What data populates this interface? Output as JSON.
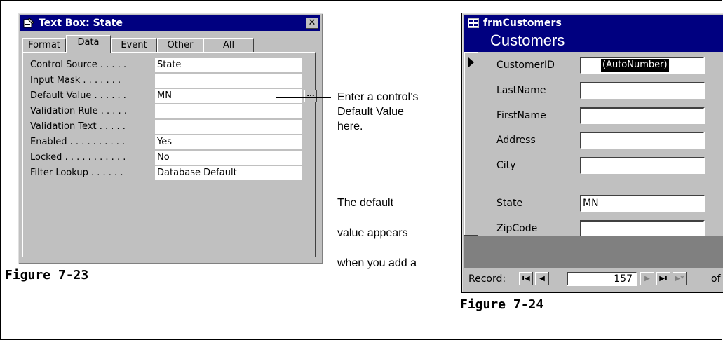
{
  "properties_window": {
    "title": "Text Box: State",
    "close_glyph": "✕",
    "tabs": [
      "Format",
      "Data",
      "Event",
      "Other",
      "All"
    ],
    "active_tab": "Data",
    "properties": [
      {
        "label": "Control Source . . . . .",
        "value": "State"
      },
      {
        "label": "Input Mask . . . . . . .",
        "value": ""
      },
      {
        "label": "Default Value . . . . . .",
        "value": "MN"
      },
      {
        "label": "Validation Rule . . . . .",
        "value": ""
      },
      {
        "label": "Validation Text . . . . .",
        "value": ""
      },
      {
        "label": "Enabled . . . . . . . . . .",
        "value": "Yes"
      },
      {
        "label": "Locked . . . . . . . . . . .",
        "value": "No"
      },
      {
        "label": "Filter Lookup . . . . . .",
        "value": "Database Default"
      }
    ],
    "builder_button": "..."
  },
  "form_window": {
    "title": "frmCustomers",
    "header": "Customers",
    "fields": [
      {
        "label": "CustomerID",
        "value": "(AutoNumber)"
      },
      {
        "label": "LastName",
        "value": ""
      },
      {
        "label": "FirstName",
        "value": ""
      },
      {
        "label": "Address",
        "value": ""
      },
      {
        "label": "City",
        "value": ""
      },
      {
        "label": "State",
        "value": "MN"
      },
      {
        "label": "ZipCode",
        "value": ""
      }
    ],
    "navigation": {
      "label": "Record:",
      "first": "I◀",
      "prev": "◀",
      "record_number": "157",
      "next": "▶",
      "last": "▶I",
      "new": "▶*",
      "of": "of"
    }
  },
  "callouts": {
    "default_value": [
      "Enter a control’s",
      "Default Value",
      "here."
    ],
    "default_appears": [
      "The default",
      "value appears",
      "when you add a"
    ]
  },
  "figures": {
    "left": "Figure 7-23",
    "right": "Figure 7-24"
  },
  "colors": {
    "title_bar": "#000080",
    "window_face": "#c0c0c0"
  }
}
